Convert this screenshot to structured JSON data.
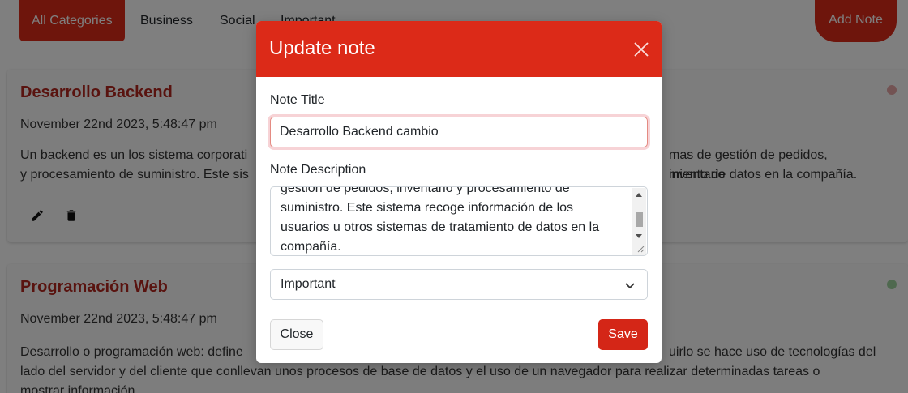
{
  "nav": {
    "categories": [
      "All Categories",
      "Business",
      "Social",
      "Important"
    ],
    "add_note": "Add Note"
  },
  "notes": [
    {
      "title": "Desarrollo Backend",
      "date": "November 22nd 2023, 5:48:47 pm",
      "desc_left": "Un backend es un los sistema corporati",
      "desc_right": "mas de gestión de pedidos, inventario",
      "desc_line2_left": "y procesamiento de suministro. Este sis",
      "desc_line2_right": "miento de datos en la compañía.",
      "status_color": "#e6a6a6"
    },
    {
      "title": "Programación Web",
      "date": "November 22nd 2023, 5:48:47 pm",
      "desc_left": "Desarrollo o programación web: define",
      "desc_right": "uirlo se hace uso de tecnologías del",
      "desc_line2": "lado del servidor y del cliente que conllevan unos procesos de base de datos y el uso de un navegador para realizar determinadas tareas o",
      "desc_line3": "mostrar información.",
      "status_color": "#9fd39f"
    }
  ],
  "modal": {
    "title": "Update note",
    "title_label": "Note Title",
    "title_value": "Desarrollo Backend cambio",
    "description_label": "Note Description",
    "description_lines": [
      "gestión de pedidos, inventario y procesamiento de",
      "suministro. Este sistema recoge información de los",
      "usuarios u otros sistemas de tratamiento de datos en la",
      "compañía."
    ],
    "category_value": "Important",
    "close_label": "Close",
    "save_label": "Save"
  },
  "colors": {
    "accent": "#dc2a18",
    "title_red": "#b3261e"
  }
}
